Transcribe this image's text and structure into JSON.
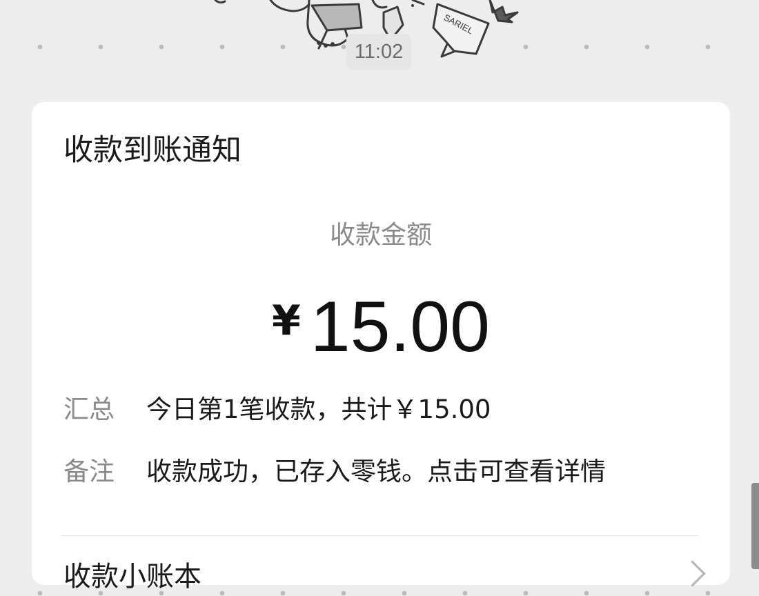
{
  "chat": {
    "timestamp": "11:02"
  },
  "wallpaper": {
    "sticker_text": "SARIEL"
  },
  "notification": {
    "title": "收款到账通知",
    "amount_label": "收款金额",
    "currency_symbol": "¥",
    "amount": "15.00",
    "summary_label": "汇总",
    "summary_value": "今日第1笔收款，共计￥15.00",
    "remark_label": "备注",
    "remark_value": "收款成功，已存入零钱。点击可查看详情",
    "footer_link": "收款小账本",
    "footer_icon": "chevron-right-icon"
  }
}
